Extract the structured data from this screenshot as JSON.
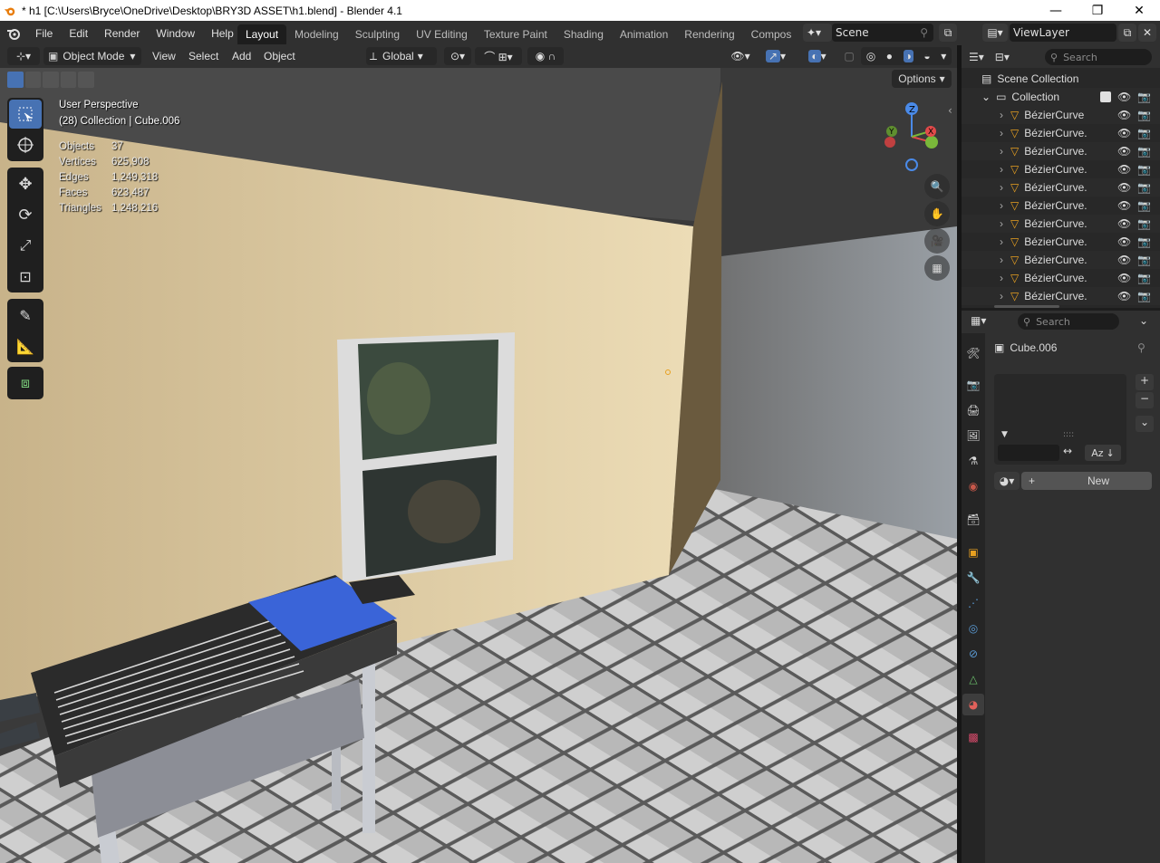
{
  "window": {
    "title": "* h1 [C:\\Users\\Bryce\\OneDrive\\Desktop\\BRY3D ASSET\\h1.blend] - Blender 4.1",
    "minimize": "—",
    "maximize": "❐",
    "close": "✕"
  },
  "menu": [
    "File",
    "Edit",
    "Render",
    "Window",
    "Help"
  ],
  "workspaces": [
    "Layout",
    "Modeling",
    "Sculpting",
    "UV Editing",
    "Texture Paint",
    "Shading",
    "Animation",
    "Rendering",
    "Compos"
  ],
  "active_workspace": "Layout",
  "scene_name": "Scene",
  "view_layer": "ViewLayer",
  "viewport_header": {
    "mode": "Object Mode",
    "view": "View",
    "select": "Select",
    "add": "Add",
    "object": "Object",
    "orientation": "Global",
    "options": "Options"
  },
  "overlay": {
    "perspective": "User Perspective",
    "collection": "(28) Collection | Cube.006",
    "stats": [
      {
        "label": "Objects",
        "value": "37"
      },
      {
        "label": "Vertices",
        "value": "625,908"
      },
      {
        "label": "Edges",
        "value": "1,249,318"
      },
      {
        "label": "Faces",
        "value": "623,487"
      },
      {
        "label": "Triangles",
        "value": "1,248,216"
      }
    ]
  },
  "gizmo": {
    "z": "Z",
    "y": "Y",
    "x": "X"
  },
  "outliner": {
    "search_placeholder": "Search",
    "scene_collection": "Scene Collection",
    "collection": "Collection",
    "items": [
      "BézierCurve",
      "BézierCurve.",
      "BézierCurve.",
      "BézierCurve.",
      "BézierCurve.",
      "BézierCurve.",
      "BézierCurve.",
      "BézierCurve.",
      "BézierCurve.",
      "BézierCurve.",
      "BézierCurve."
    ]
  },
  "properties": {
    "search_placeholder": "Search",
    "object_name": "Cube.006",
    "new_button": "New",
    "plus": "+",
    "minus": "−",
    "sort_label": "Az"
  },
  "colors": {
    "accent": "#4772b3",
    "header": "#303030",
    "panel": "#282828",
    "wall": "#e6d3a8",
    "blue_block": "#3a64d8"
  }
}
